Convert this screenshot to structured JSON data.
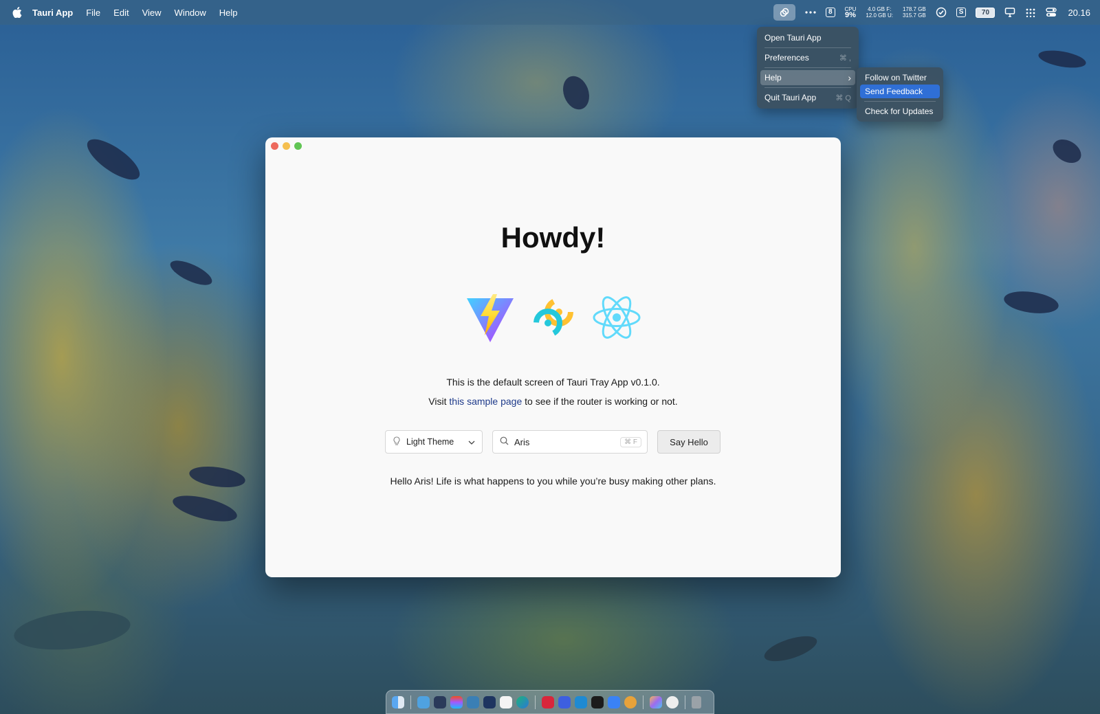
{
  "menubar": {
    "app_name": "Tauri App",
    "menus": [
      "File",
      "Edit",
      "View",
      "Window",
      "Help"
    ],
    "status": {
      "badge_number": "8",
      "cpu_label": "CPU",
      "cpu_value": "9%",
      "mem_line_1": "4.0 GB F:",
      "mem_line_2": "12.0 GB U:",
      "disk_line_1": "178.7 GB",
      "disk_line_2": "315.7 GB",
      "skype_letter": "S",
      "battery": "70",
      "clock": "20.16"
    }
  },
  "tray_menu": {
    "items": [
      {
        "label": "Open Tauri App",
        "shortcut": ""
      },
      {
        "label": "Preferences",
        "shortcut": "⌘ ,"
      },
      {
        "label": "Help",
        "shortcut": "›"
      },
      {
        "label": "Quit Tauri App",
        "shortcut": "⌘ Q"
      }
    ],
    "submenu": [
      "Follow on Twitter",
      "Send Feedback",
      "Check for Updates"
    ]
  },
  "window": {
    "title": "Howdy!",
    "description": "This is the default screen of Tauri Tray App v0.1.0.",
    "visit_prefix": "Visit ",
    "visit_link": "this sample page",
    "visit_suffix": " to see if the router is working or not.",
    "theme_select": "Light Theme",
    "name_input_value": "Aris",
    "shortcut_hint": "⌘ F",
    "button_label": "Say Hello",
    "greeting": "Hello Aris! Life is what happens to you while you’re busy making other plans."
  },
  "colors": {
    "link": "#1e3a8a",
    "menu_selected": "#2f6fd6"
  }
}
